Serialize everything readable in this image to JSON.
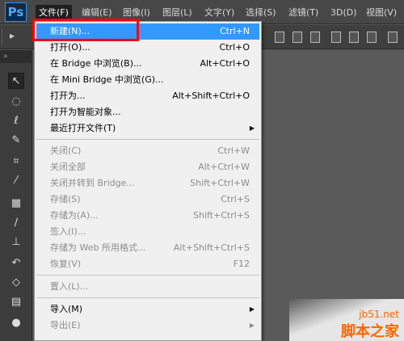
{
  "app": {
    "logo": "Ps"
  },
  "menubar": {
    "items": [
      {
        "label": "文件(F)",
        "active": true
      },
      {
        "label": "编辑(E)"
      },
      {
        "label": "图像(I)"
      },
      {
        "label": "图层(L)"
      },
      {
        "label": "文字(Y)"
      },
      {
        "label": "选择(S)"
      },
      {
        "label": "滤镜(T)"
      },
      {
        "label": "3D(D)"
      },
      {
        "label": "视图(V)"
      }
    ]
  },
  "options_bar": {
    "arrow_glyph": "▸"
  },
  "tools": {
    "header": "»",
    "icons": [
      {
        "name": "move-tool-icon",
        "glyph": "↖"
      },
      {
        "name": "marquee-tool-icon",
        "glyph": "◌"
      },
      {
        "name": "lasso-tool-icon",
        "glyph": "ℓ"
      },
      {
        "name": "quick-select-tool-icon",
        "glyph": "✎"
      },
      {
        "name": "crop-tool-icon",
        "glyph": "⌗"
      },
      {
        "name": "eyedropper-tool-icon",
        "glyph": "⁄"
      },
      {
        "name": "healing-brush-tool-icon",
        "glyph": "▦"
      },
      {
        "name": "brush-tool-icon",
        "glyph": "∕"
      },
      {
        "name": "clone-stamp-tool-icon",
        "glyph": "⊥"
      },
      {
        "name": "history-brush-tool-icon",
        "glyph": "↶"
      },
      {
        "name": "eraser-tool-icon",
        "glyph": "◇"
      },
      {
        "name": "gradient-tool-icon",
        "glyph": "▤"
      },
      {
        "name": "blur-tool-icon",
        "glyph": "●"
      },
      {
        "name": "dodge-tool-icon",
        "glyph": "○"
      }
    ]
  },
  "file_menu": {
    "items": [
      {
        "label": "新建(N)...",
        "shortcut": "Ctrl+N",
        "enabled": true,
        "highlighted": true
      },
      {
        "label": "打开(O)...",
        "shortcut": "Ctrl+O",
        "enabled": true
      },
      {
        "label": "在 Bridge 中浏览(B)...",
        "shortcut": "Alt+Ctrl+O",
        "enabled": true
      },
      {
        "label": "在 Mini Bridge 中浏览(G)...",
        "shortcut": "",
        "enabled": true
      },
      {
        "label": "打开为...",
        "shortcut": "Alt+Shift+Ctrl+O",
        "enabled": true
      },
      {
        "label": "打开为智能对象...",
        "shortcut": "",
        "enabled": true
      },
      {
        "label": "最近打开文件(T)",
        "shortcut": "",
        "enabled": true,
        "submenu": true
      },
      {
        "separator": true
      },
      {
        "label": "关闭(C)",
        "shortcut": "Ctrl+W",
        "enabled": false
      },
      {
        "label": "关闭全部",
        "shortcut": "Alt+Ctrl+W",
        "enabled": false
      },
      {
        "label": "关闭并转到 Bridge...",
        "shortcut": "Shift+Ctrl+W",
        "enabled": false
      },
      {
        "label": "存储(S)",
        "shortcut": "Ctrl+S",
        "enabled": false
      },
      {
        "label": "存储为(A)...",
        "shortcut": "Shift+Ctrl+S",
        "enabled": false
      },
      {
        "label": "签入(I)...",
        "shortcut": "",
        "enabled": false
      },
      {
        "label": "存储为 Web 所用格式...",
        "shortcut": "Alt+Shift+Ctrl+S",
        "enabled": false
      },
      {
        "label": "恢复(V)",
        "shortcut": "F12",
        "enabled": false
      },
      {
        "separator": true
      },
      {
        "label": "置入(L)...",
        "shortcut": "",
        "enabled": false
      },
      {
        "separator": true
      },
      {
        "label": "导入(M)",
        "shortcut": "",
        "enabled": true,
        "submenu": true
      },
      {
        "label": "导出(E)",
        "shortcut": "",
        "enabled": false,
        "submenu": true
      }
    ]
  },
  "watermark": {
    "url": "jb51.net",
    "name": "脚本之家"
  },
  "colors": {
    "highlight": "#3399ff",
    "annotation": "#ff0000",
    "watermark": "#ff6600"
  }
}
